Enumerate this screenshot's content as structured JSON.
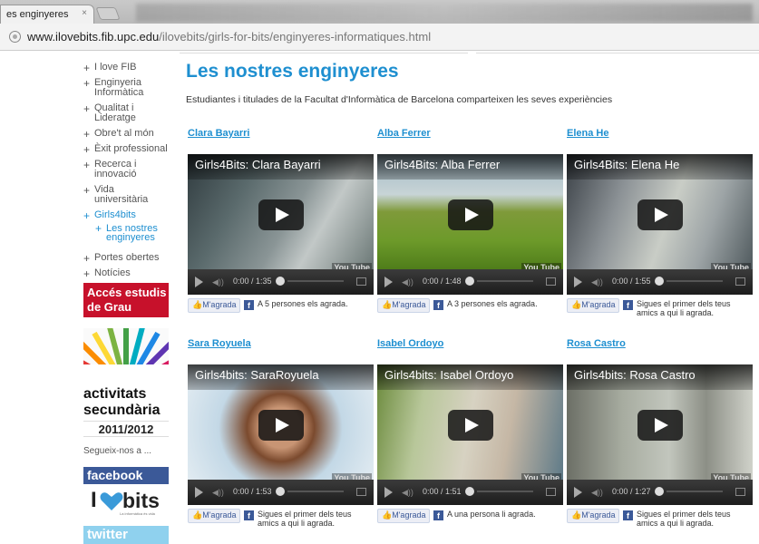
{
  "browser": {
    "tab_title": "es enginyeres",
    "tab_close": "×",
    "url_domain": "www.ilovebits.fib.upc.edu",
    "url_path": "/ilovebits/girls-for-bits/enginyeres-informatiques.html"
  },
  "sidebar": {
    "items": [
      {
        "label": "I love FIB"
      },
      {
        "label": "Enginyeria Informàtica"
      },
      {
        "label": "Qualitat i Lideratge"
      },
      {
        "label": "Obre't al món"
      },
      {
        "label": "Èxit professional"
      },
      {
        "label": "Recerca i innovació"
      },
      {
        "label": "Vida universitària"
      },
      {
        "label": "Girls4bits"
      },
      {
        "label": "Portes obertes"
      },
      {
        "label": "Notícies"
      }
    ],
    "subitem": "Les nostres enginyeres",
    "acces": "Accés estudis de Grau",
    "activitats": "activitats secundària",
    "activitats_year": "2011/2012",
    "segueix": "Segueix-nos a ...",
    "facebook": "facebook",
    "ilove_i": "I",
    "ilove_bits": "bits",
    "ilove_small": "La informàtica és vida",
    "twitter": "twitter"
  },
  "main": {
    "title": "Les nostres enginyeres",
    "subtitle": "Estudiantes i titulades de la Facultat d'Informàtica de Barcelona comparteixen les seves experiències",
    "cards": [
      {
        "name": "Clara Bayarri",
        "video_title": "Girls4Bits: Clara Bayarri",
        "time": "0:00 / 1:35",
        "like": "M'agrada",
        "like_text": "A 5 persones els agrada."
      },
      {
        "name": "Alba Ferrer",
        "video_title": "Girls4Bits: Alba Ferrer",
        "time": "0:00 / 1:48",
        "like": "M'agrada",
        "like_text": "A 3 persones els agrada."
      },
      {
        "name": "Elena He",
        "video_title": "Girls4Bits: Elena He",
        "time": "0:00 / 1:55",
        "like": "M'agrada",
        "like_text": "Sigues el primer dels teus amics a qui li agrada."
      },
      {
        "name": "Sara Royuela",
        "video_title": "Girls4bits: SaraRoyuela",
        "time": "0:00 / 1:53",
        "like": "M'agrada",
        "like_text": "Sigues el primer dels teus amics a qui li agrada."
      },
      {
        "name": "Isabel Ordoyo",
        "video_title": "Girls4bits: Isabel Ordoyo",
        "time": "0:00 / 1:51",
        "like": "M'agrada",
        "like_text": "A una persona li agrada."
      },
      {
        "name": "Rosa Castro",
        "video_title": "Girls4bits: Rosa Castro",
        "time": "0:00 / 1:27",
        "like": "M'agrada",
        "like_text": "Sigues el primer dels teus amics a qui li agrada."
      }
    ],
    "youtube": "You Tube"
  },
  "colors": {
    "accent": "#1e8fd0",
    "acces_red": "#c7112b",
    "facebook_blue": "#3b5998",
    "twitter_blue": "#8fd1ee"
  }
}
